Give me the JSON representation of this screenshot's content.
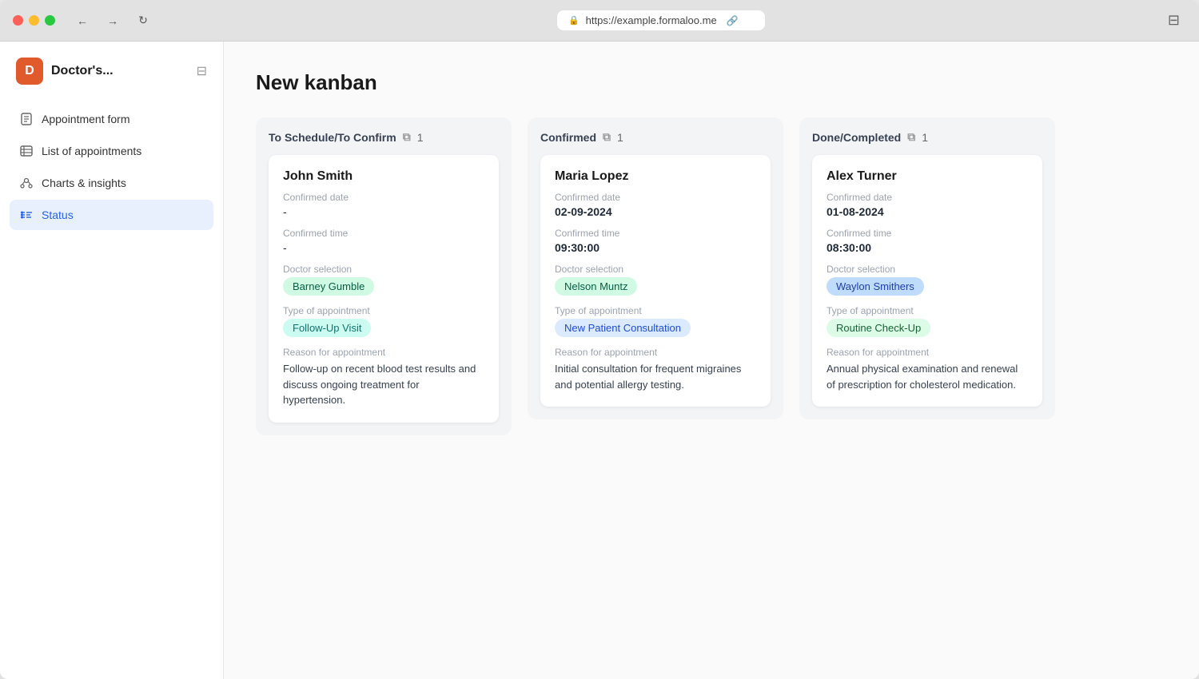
{
  "browser": {
    "url": "https://example.formaloo.me",
    "back_label": "←",
    "forward_label": "→",
    "refresh_label": "↻",
    "layout_label": "⊟"
  },
  "sidebar": {
    "logo_letter": "D",
    "app_name": "Doctor's...",
    "items": [
      {
        "id": "appointment-form",
        "label": "Appointment form",
        "active": false
      },
      {
        "id": "list-of-appointments",
        "label": "List of appointments",
        "active": false
      },
      {
        "id": "charts-insights",
        "label": "Charts & insights",
        "active": false
      },
      {
        "id": "status",
        "label": "Status",
        "active": true
      }
    ]
  },
  "main": {
    "page_title": "New kanban",
    "columns": [
      {
        "id": "to-schedule",
        "title": "To Schedule/To Confirm",
        "count": 1,
        "cards": [
          {
            "patient_name": "John Smith",
            "confirmed_date_label": "Confirmed date",
            "confirmed_date": "-",
            "confirmed_time_label": "Confirmed time",
            "confirmed_time": "-",
            "doctor_selection_label": "Doctor selection",
            "doctor": "Barney Gumble",
            "doctor_badge_class": "badge-green",
            "appointment_type_label": "Type of appointment",
            "appointment_type": "Follow-Up Visit",
            "appointment_badge_class": "badge-teal",
            "reason_label": "Reason for appointment",
            "reason": "Follow-up on recent blood test results and discuss ongoing treatment for hypertension."
          }
        ]
      },
      {
        "id": "confirmed",
        "title": "Confirmed",
        "count": 1,
        "cards": [
          {
            "patient_name": "Maria Lopez",
            "confirmed_date_label": "Confirmed date",
            "confirmed_date": "02-09-2024",
            "confirmed_time_label": "Confirmed time",
            "confirmed_time": "09:30:00",
            "doctor_selection_label": "Doctor selection",
            "doctor": "Nelson Muntz",
            "doctor_badge_class": "badge-green",
            "appointment_type_label": "Type of appointment",
            "appointment_type": "New Patient Consultation",
            "appointment_badge_class": "badge-blue-light",
            "reason_label": "Reason for appointment",
            "reason": "Initial consultation for frequent migraines and potential allergy testing."
          }
        ]
      },
      {
        "id": "done-completed",
        "title": "Done/Completed",
        "count": 1,
        "cards": [
          {
            "patient_name": "Alex Turner",
            "confirmed_date_label": "Confirmed date",
            "confirmed_date": "01-08-2024",
            "confirmed_time_label": "Confirmed time",
            "confirmed_time": "08:30:00",
            "doctor_selection_label": "Doctor selection",
            "doctor": "Waylon Smithers",
            "doctor_badge_class": "badge-blue",
            "appointment_type_label": "Type of appointment",
            "appointment_type": "Routine Check-Up",
            "appointment_badge_class": "badge-green-light",
            "reason_label": "Reason for appointment",
            "reason": "Annual physical examination and renewal of prescription for cholesterol medication."
          }
        ]
      }
    ]
  }
}
